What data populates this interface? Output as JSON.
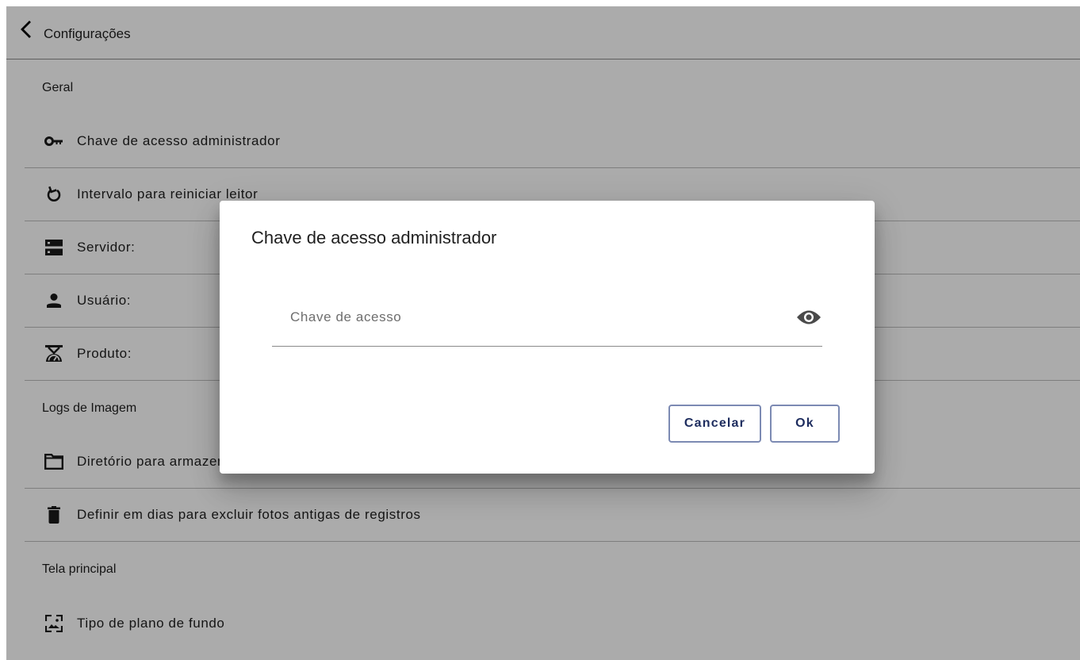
{
  "header": {
    "title": "Configurações",
    "back_icon": "chevron-left-icon"
  },
  "sections": [
    {
      "title": "Geral",
      "items": [
        {
          "label": "Chave de acesso administrador",
          "icon": "key-icon"
        },
        {
          "label": "Intervalo para reiniciar leitor",
          "icon": "restart-icon"
        },
        {
          "label": "Servidor:",
          "icon": "server-icon"
        },
        {
          "label": "Usuário:",
          "icon": "person-icon"
        },
        {
          "label": "Produto:",
          "icon": "scale-icon"
        }
      ]
    },
    {
      "title": "Logs de Imagem",
      "items": [
        {
          "label": "Diretório para armazenar fotos de registros",
          "icon": "folder-icon"
        },
        {
          "label": "Definir em dias para excluir fotos antigas de registros",
          "icon": "trash-icon"
        }
      ]
    },
    {
      "title": "Tela principal",
      "items": [
        {
          "label": "Tipo de plano de fundo",
          "icon": "wallpaper-icon"
        }
      ]
    }
  ],
  "dialog": {
    "title": "Chave de acesso administrador",
    "input_placeholder": "Chave de acesso",
    "input_value": "",
    "visibility_icon": "eye-icon",
    "cancel_label": "Cancelar",
    "ok_label": "Ok"
  },
  "colors": {
    "scrim": "#000000",
    "button_border": "#7c8ab3",
    "button_text": "#1d2c5e",
    "text": "#1f1f1f"
  }
}
